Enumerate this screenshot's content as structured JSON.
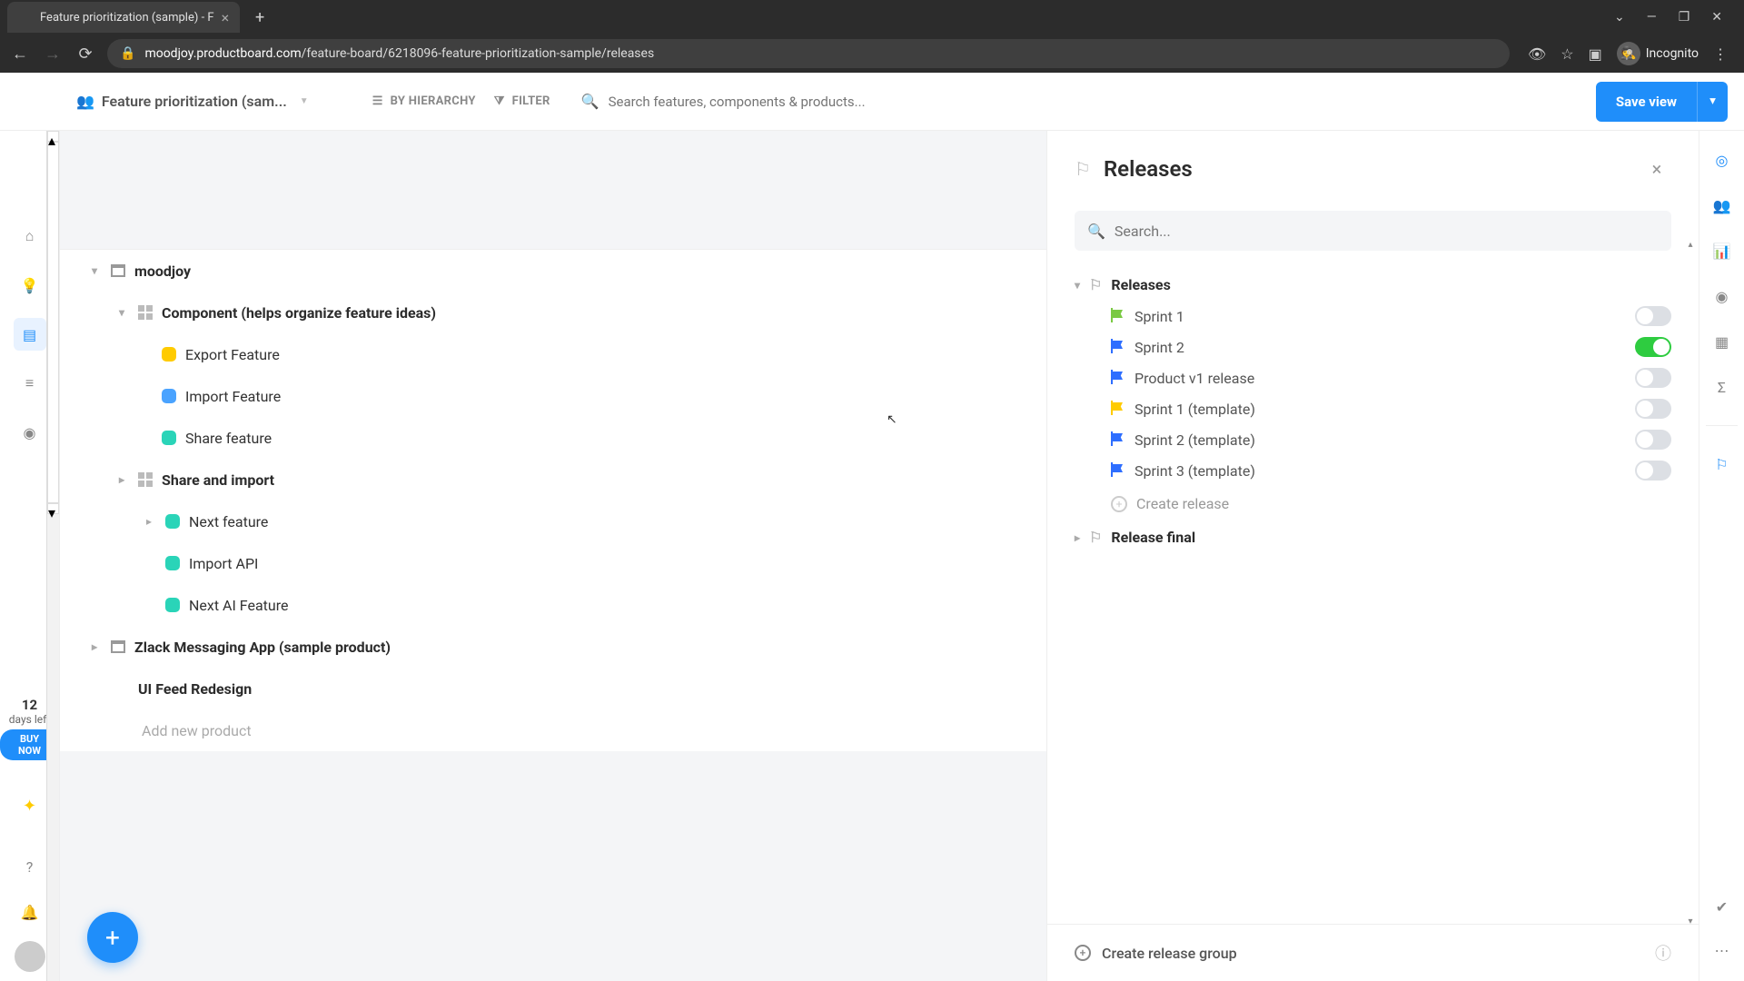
{
  "browser": {
    "tab_title": "Feature prioritization (sample) - F",
    "url_host": "moodjoy.productboard.com",
    "url_path": "/feature-board/6218096-feature-prioritization-sample/releases",
    "incognito_label": "Incognito"
  },
  "header": {
    "board_title": "Feature prioritization (sam...",
    "by_hierarchy": "BY HIERARCHY",
    "filter": "FILTER",
    "search_placeholder": "Search features, components & products...",
    "save_view": "Save view"
  },
  "left_rail": {
    "trial_days": "12",
    "trial_label": "days left",
    "buy_now": "BUY NOW"
  },
  "tree": {
    "product": "moodjoy",
    "component": "Component (helps organize feature ideas)",
    "features": [
      {
        "label": "Export Feature",
        "color": "#ffcb00"
      },
      {
        "label": "Import Feature",
        "color": "#4aa3ff"
      },
      {
        "label": "Share feature",
        "color": "#2ad4b8"
      }
    ],
    "share_import": "Share and import",
    "sub_features": [
      {
        "label": "Next feature",
        "color": "#2ad4b8"
      },
      {
        "label": "Import API",
        "color": "#2ad4b8"
      },
      {
        "label": "Next AI Feature",
        "color": "#2ad4b8"
      }
    ],
    "zlack": "Zlack Messaging App (sample product)",
    "ui_feed": "UI Feed Redesign",
    "add_product": "Add new product"
  },
  "panel": {
    "title": "Releases",
    "search_placeholder": "Search...",
    "group_name": "Releases",
    "items": [
      {
        "name": "Sprint 1",
        "color": "green",
        "on": false
      },
      {
        "name": "Sprint 2",
        "color": "blue",
        "on": true
      },
      {
        "name": "Product v1 release",
        "color": "blue",
        "on": false
      },
      {
        "name": "Sprint 1 (template)",
        "color": "yellow",
        "on": false
      },
      {
        "name": "Sprint 2 (template)",
        "color": "blue",
        "on": false
      },
      {
        "name": "Sprint 3 (template)",
        "color": "blue",
        "on": false
      }
    ],
    "create_release": "Create release",
    "release_final": "Release final",
    "create_group": "Create release group"
  }
}
